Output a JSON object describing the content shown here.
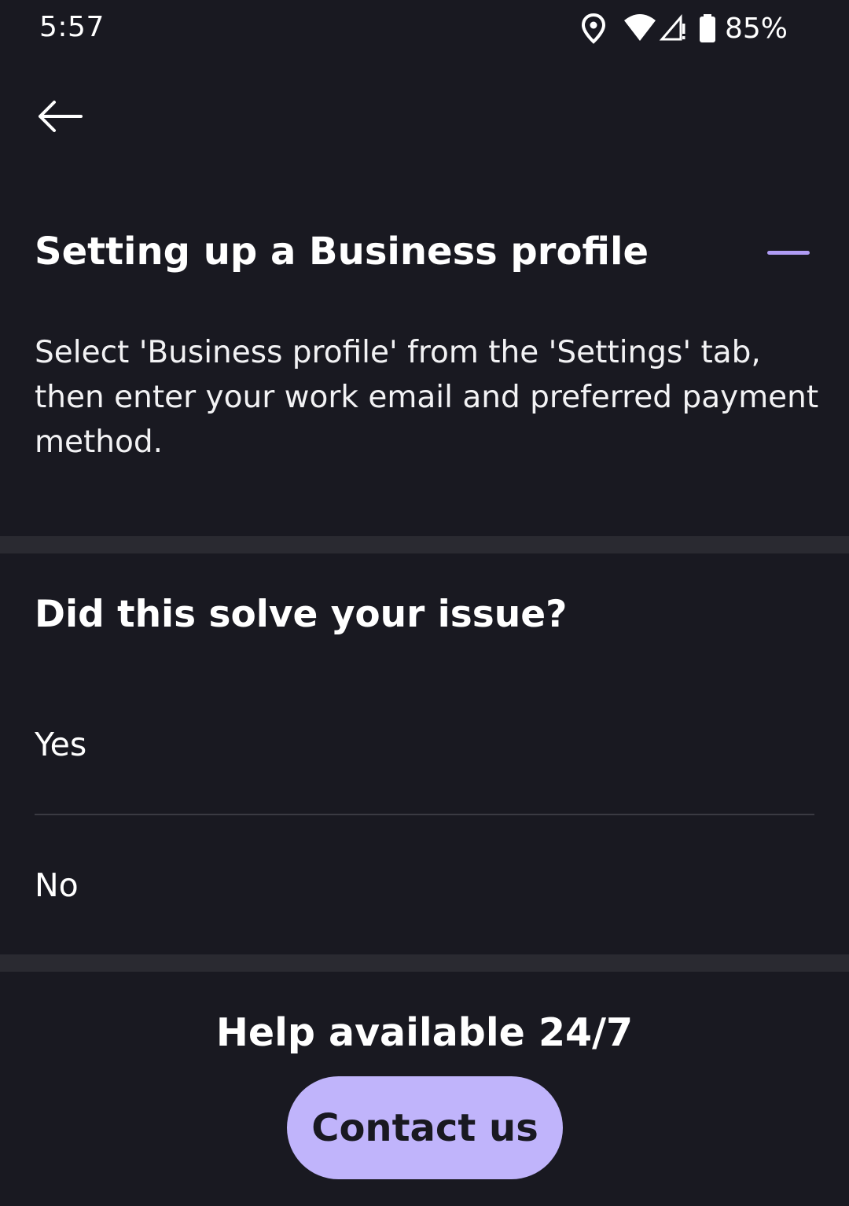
{
  "status_bar": {
    "time": "5:57",
    "battery_percent": "85%",
    "icons": [
      "location-icon",
      "wifi-icon",
      "cellular-no-signal-icon",
      "battery-icon"
    ]
  },
  "header": {
    "back_icon": "arrow-left-icon"
  },
  "faq": {
    "title": "Setting up a Business profile",
    "answer": "Select 'Business profile' from the 'Settings' tab, then enter your work email and preferred payment method.",
    "collapse_icon": "minus-icon"
  },
  "feedback": {
    "question": "Did this solve your issue?",
    "options": [
      "Yes",
      "No"
    ]
  },
  "help": {
    "title": "Help available 24/7",
    "contact_label": "Contact us"
  },
  "colors": {
    "background": "#191921",
    "accent": "#b09cf5",
    "button_fill": "#c0b4fb",
    "divider": "#2a2a31"
  }
}
